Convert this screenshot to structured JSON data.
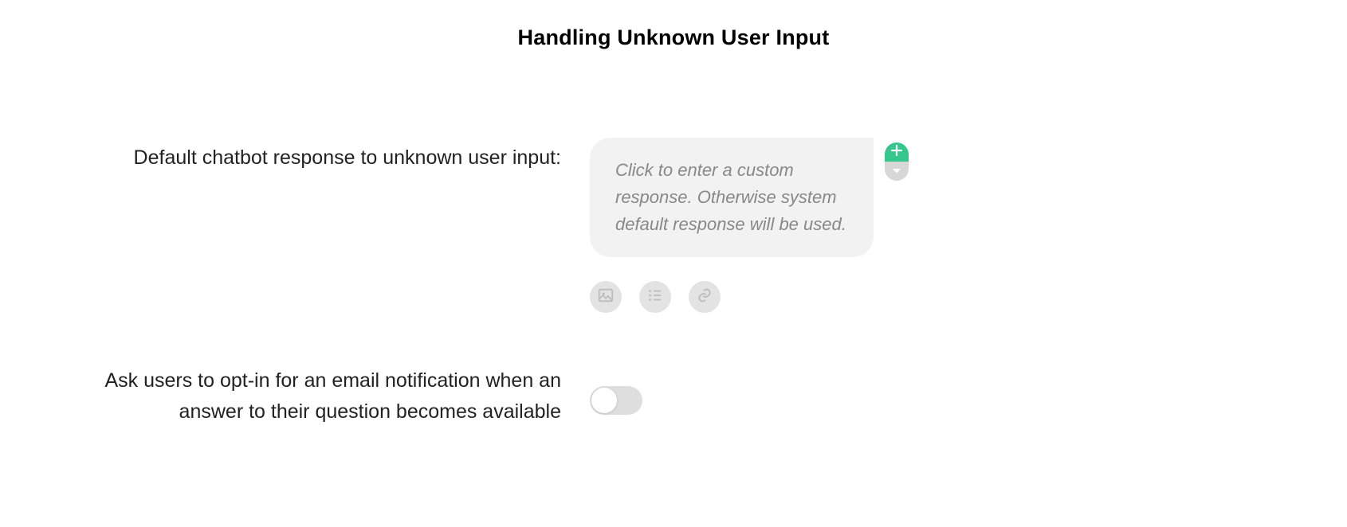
{
  "header": {
    "title": "Handling Unknown User Input"
  },
  "default_response": {
    "label": "Default chatbot response to unknown user input:",
    "placeholder": "Click to enter a custom response. Otherwise system default response will be used."
  },
  "opt_in": {
    "label": "Ask users to opt-in for an email notification when an answer to their question becomes available",
    "enabled": false
  }
}
